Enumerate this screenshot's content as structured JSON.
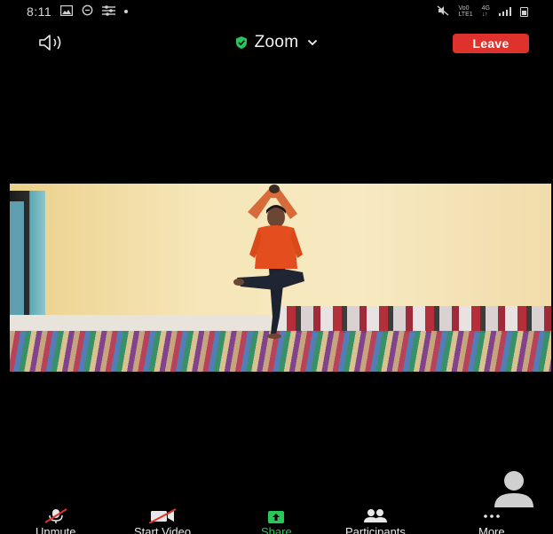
{
  "status_bar": {
    "time": "8:11",
    "left_icons": [
      "gallery-icon",
      "circle-icon",
      "settings-lines-icon",
      "dot-icon"
    ],
    "right_icons": [
      "mute-icon",
      "volte-icon",
      "4g-icon",
      "signal-icon",
      "battery-icon"
    ],
    "volte_text_top": "Vo0",
    "volte_text_bottom": "LTE1",
    "network_text_top": "4G",
    "network_text_bottom": "↓↑"
  },
  "header": {
    "speaker_icon": "speaker-icon",
    "meeting_title": "Zoom",
    "shield_icon": "shield-icon",
    "chevron_icon": "chevron-down-icon",
    "leave_label": "Leave",
    "leave_color": "#e0322c",
    "shield_color": "#2ac65a"
  },
  "video": {
    "description_icon": "participant-video"
  },
  "avatar": {
    "icon": "avatar-icon"
  },
  "toolbar": {
    "items": [
      {
        "label": "Unmute",
        "icon": "microphone-muted-icon"
      },
      {
        "label": "Start Video",
        "icon": "video-off-icon"
      },
      {
        "label": "Share",
        "icon": "share-icon"
      },
      {
        "label": "Participants",
        "icon": "participants-icon"
      },
      {
        "label": "More",
        "icon": "more-icon"
      }
    ],
    "share_color": "#2ac65a",
    "muted_slash_color": "#e0322c"
  }
}
